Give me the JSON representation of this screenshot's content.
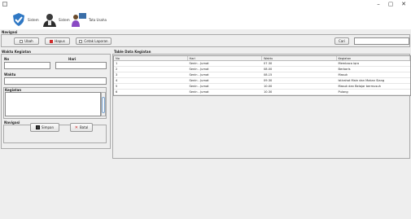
{
  "window": {
    "minimize": "–",
    "maximize": "▢",
    "close": "✕"
  },
  "toolbar": [
    {
      "label": "Sistem",
      "icon": "shield-check-icon"
    },
    {
      "label": "Sistem",
      "icon": "user-avatar-icon"
    },
    {
      "label": "Tata Usaha",
      "icon": "teacher-icon"
    }
  ],
  "navigasi": {
    "title": "Navigasi",
    "buttons": [
      "Ubah",
      "Hapus",
      "Cetak Laporan"
    ],
    "search_button": "Cari",
    "search_value": ""
  },
  "waktu_kegiatan": {
    "title": "Waktu Kegiatan",
    "no_label": "No",
    "hari_label": "Hari",
    "waktu_label": "Waktu",
    "kegiatan_label": "Kegiatan",
    "no_value": "",
    "hari_value": "",
    "waktu_value": "",
    "kegiatan_value": "",
    "navigasi_label": "Navigasi",
    "simpan": "Simpan",
    "batal": "Batal"
  },
  "table": {
    "title": "Table Data Kegiatan",
    "columns": [
      "No",
      "Hari",
      "Waktu",
      "Kegiatan"
    ],
    "rows": [
      [
        "1",
        "Senin - Jumat",
        "07.30",
        "Membaca iqra"
      ],
      [
        "2",
        "Senin - Jumat",
        "08.00",
        "Berbaris"
      ],
      [
        "3",
        "Senin - Jumat",
        "08.15",
        "Masuk"
      ],
      [
        "4",
        "Senin - Jumat",
        "09.30",
        "Istirahat Main dan Makan Siang"
      ],
      [
        "5",
        "Senin - Jumat",
        "10.00",
        "Masuk dan Belajar bermusuh"
      ],
      [
        "6",
        "Senin - Jumat",
        "10.30",
        "Pulang"
      ]
    ]
  },
  "colors": {
    "accent": "#2f78c4",
    "cancel": "#d02a2a"
  }
}
